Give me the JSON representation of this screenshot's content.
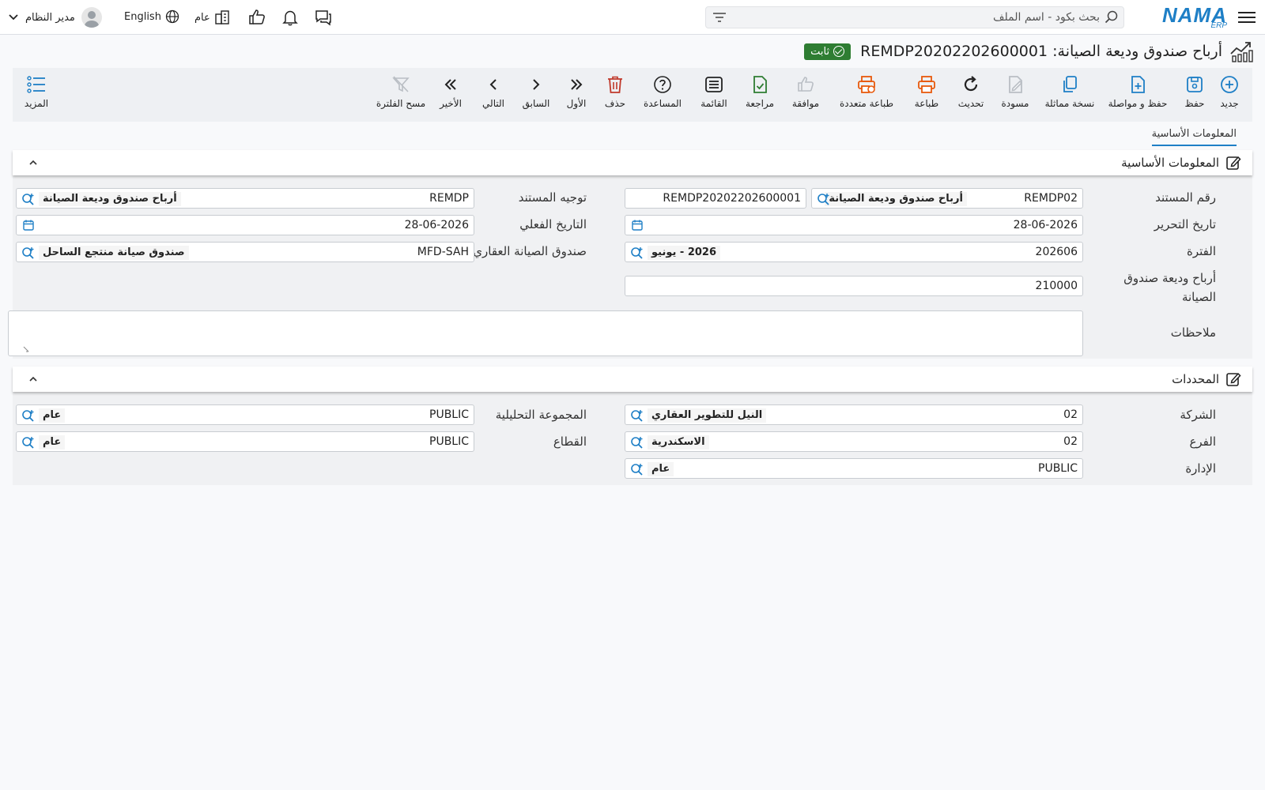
{
  "header": {
    "logo_main": "NAMA",
    "logo_sub": "ERP",
    "search_placeholder": "بحث بكود - اسم الملف",
    "language": "English",
    "branch_label": "عام",
    "user_name": "مدير النظام"
  },
  "page": {
    "title": "أرباح صندوق وديعة الصيانة: REMDP20202202600001",
    "status": "ثابت"
  },
  "toolbar": {
    "new": "جديد",
    "save": "حفظ",
    "save_continue": "حفظ و مواصلة",
    "duplicate": "نسخة مماثلة",
    "draft": "مسودة",
    "refresh": "تحديث",
    "print": "طباعة",
    "multi_print": "طباعة متعددة",
    "approve": "موافقة",
    "review": "مراجعة",
    "list": "القائمة",
    "help": "المساعدة",
    "delete": "حذف",
    "first": "الأول",
    "previous": "السابق",
    "next": "التالي",
    "last": "الأخير",
    "clear_filter": "مسح الفلترة",
    "more": "المزيد"
  },
  "colors": {
    "accent": "#1e7fc6",
    "success": "#2e7d32",
    "danger": "#c0392b",
    "print_orange": "#e8590c",
    "icon_disabled": "#b9bec4"
  },
  "tabs": {
    "basic": "المعلومات الأساسية"
  },
  "basic": {
    "section_title": "المعلومات الأساسية",
    "doc_number_label": "رقم المستند",
    "doc_number_book": "REMDP02",
    "doc_number_book_desc": "أرباح صندوق وديعة الصيانة",
    "doc_number_code": "REMDP20202202600001",
    "doc_direction_label": "توجيه المستند",
    "doc_direction_code": "REMDP",
    "doc_direction_desc": "أرباح صندوق وديعة الصيانة",
    "issue_date_label": "تاريخ التحرير",
    "issue_date": "28-06-2026",
    "actual_date_label": "التاريخ الفعلي",
    "actual_date": "28-06-2026",
    "period_label": "الفترة",
    "period_code": "202606",
    "period_desc": "2026 - يونيو",
    "fund_label": "صندوق الصيانة العقاري",
    "fund_code": "MFD-SAH",
    "fund_desc": "صندوق صيانة منتجع الساحل",
    "profit_label_1": "أرباح وديعة صندوق",
    "profit_label_2": "الصيانة",
    "profit_value": "210000",
    "notes_label": "ملاحظات"
  },
  "dimensions": {
    "section_title": "المحددات",
    "company_label": "الشركة",
    "company_code": "02",
    "company_desc": "النيل للتطوير العقاري",
    "analysis_label": "المجموعة التحليلية",
    "analysis_code": "PUBLIC",
    "analysis_desc": "عام",
    "branch_label": "الفرع",
    "branch_code": "02",
    "branch_desc": "الاسكندرية",
    "sector_label": "القطاع",
    "sector_code": "PUBLIC",
    "sector_desc": "عام",
    "dept_label": "الإدارة",
    "dept_code": "PUBLIC",
    "dept_desc": "عام"
  }
}
